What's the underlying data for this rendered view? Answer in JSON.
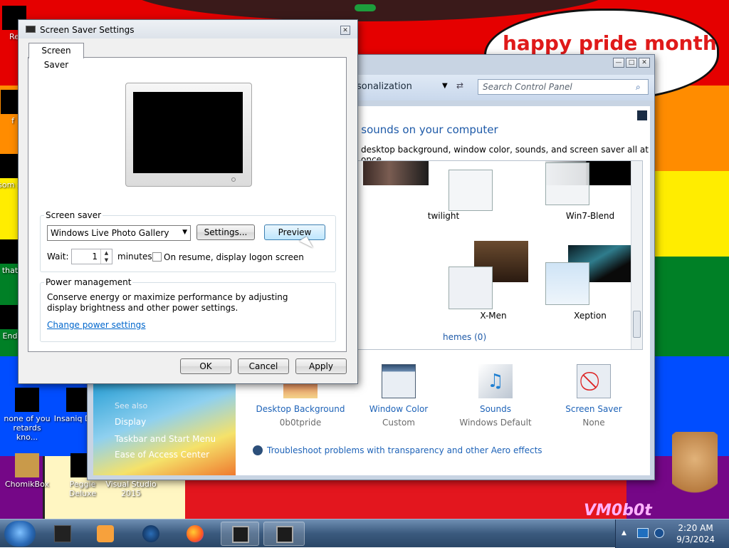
{
  "wallpaper": {
    "bubble_text": "happy pride month",
    "watermark": "VM0b0t"
  },
  "desktop_icons": [
    {
      "label": "Re",
      "pos": "top"
    },
    {
      "label": "f",
      "pos": ""
    },
    {
      "label": "som re",
      "pos": ""
    },
    {
      "label": "that",
      "pos": ""
    },
    {
      "label": "End",
      "pos": ""
    },
    {
      "label": "none of you retards kno...",
      "pos": ""
    },
    {
      "label": "Insaniq Delu",
      "pos": ""
    },
    {
      "label": "ChomikBox",
      "pos": ""
    },
    {
      "label": "Peggle Deluxe",
      "pos": ""
    },
    {
      "label": "Visual Studio 2015",
      "pos": ""
    }
  ],
  "personalization": {
    "crumb": "sonalization",
    "search_placeholder": "Search Control Panel",
    "heading": "d sounds on your computer",
    "subhead": "desktop background, window color, sounds, and screen saver all at once.",
    "themes": [
      {
        "name": "twilight"
      },
      {
        "name": "Win7-Blend"
      },
      {
        "name": "X-Men"
      },
      {
        "name": "Xeption"
      }
    ],
    "installed_themes": "hemes (0)",
    "see_also": {
      "title": "See also",
      "items": [
        "Display",
        "Taskbar and Start Menu",
        "Ease of Access Center"
      ]
    },
    "bottom": [
      {
        "label": "Desktop Background",
        "sub": "0b0tpride"
      },
      {
        "label": "Window Color",
        "sub": "Custom"
      },
      {
        "label": "Sounds",
        "sub": "Windows Default"
      },
      {
        "label": "Screen Saver",
        "sub": "None"
      }
    ],
    "troubleshoot": "Troubleshoot problems with transparency and other Aero effects"
  },
  "dialog": {
    "title": "Screen Saver Settings",
    "tab": "Screen Saver",
    "screensaver_group": "Screen saver",
    "selected_saver": "Windows Live Photo Gallery",
    "settings_btn": "Settings...",
    "preview_btn": "Preview",
    "wait_label": "Wait:",
    "wait_value": "1",
    "minutes_label": "minutes",
    "resume_label": "On resume, display logon screen",
    "power_group": "Power management",
    "power_text": "Conserve energy or maximize performance by adjusting display brightness and other power settings.",
    "power_link": "Change power settings",
    "ok": "OK",
    "cancel": "Cancel",
    "apply": "Apply"
  },
  "taskbar": {
    "time": "2:20 AM",
    "date": "9/3/2024"
  }
}
